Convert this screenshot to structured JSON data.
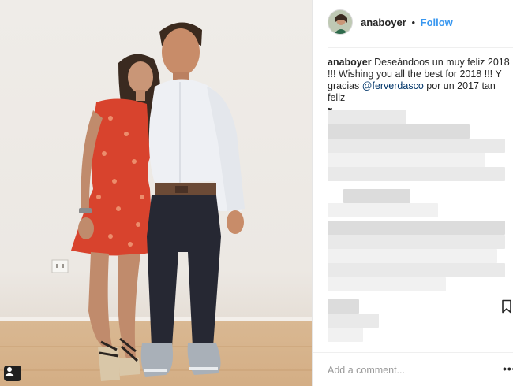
{
  "post": {
    "image_alt": "",
    "user_tag_icon": "person-tag-icon"
  },
  "header": {
    "username": "anaboyer",
    "separator": "•",
    "follow_label": "Follow"
  },
  "caption": {
    "username": "anaboyer",
    "text_before_mention": "Deseándoos un muy feliz 2018 !!! Wishing you all the best for 2018 !!! Y gracias",
    "mention": "@ferverdasco",
    "text_after_mention": "por un 2017 tan feliz",
    "emoji": "♥"
  },
  "comments": {
    "blurred": true
  },
  "footer": {
    "add_comment_placeholder": "Add a comment...",
    "more_label": "•••",
    "bookmark_icon": "bookmark-icon"
  },
  "colors": {
    "link_blue": "#3897f0",
    "mention_blue": "#003569",
    "text": "#262626",
    "placeholder": "#999999"
  }
}
